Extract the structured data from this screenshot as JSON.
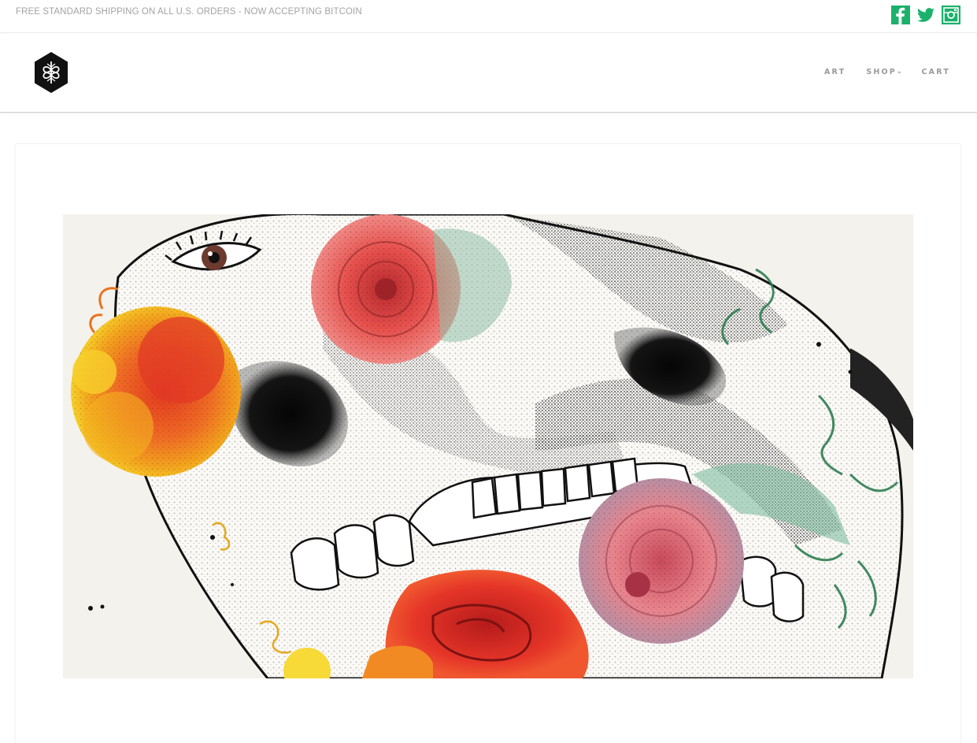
{
  "announcement": {
    "text": "FREE STANDARD SHIPPING ON ALL U.S. ORDERS - NOW ACCEPTING BITCOIN"
  },
  "social": [
    {
      "icon": "facebook-icon"
    },
    {
      "icon": "twitter-icon"
    },
    {
      "icon": "instagram-icon"
    }
  ],
  "brand": {
    "logo_icon": "hexagon-logo-icon"
  },
  "nav": {
    "items": [
      {
        "label": "ART"
      },
      {
        "label": "SHOP",
        "caret": "»"
      },
      {
        "label": "CART"
      }
    ]
  },
  "hero": {
    "image": "skull-with-flowers-artwork"
  },
  "colors": {
    "accent": "#1bb16b",
    "announcement_text": "#a3a3a3",
    "nav_text": "#9a9a9a",
    "logo": "#111111"
  }
}
